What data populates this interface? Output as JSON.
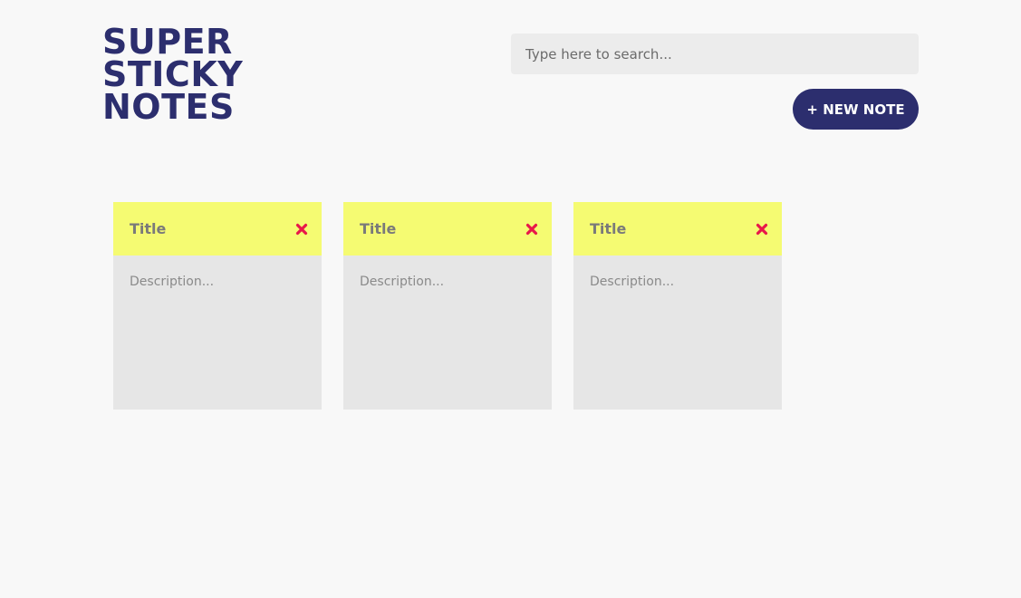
{
  "header": {
    "logo_lines": [
      "SUPER",
      "STICKY",
      "NOTES"
    ],
    "search_placeholder": "Type here to search...",
    "new_note_label": "+ NEW NOTE"
  },
  "colors": {
    "brand": "#2c2e6e",
    "note_header": "#f5fb72",
    "note_body": "#e6e6e6",
    "delete": "#e8174a"
  },
  "notes": [
    {
      "title": "Title",
      "description": "Description...",
      "delete_icon": "close-x-icon"
    },
    {
      "title": "Title",
      "description": "Description...",
      "delete_icon": "close-x-icon"
    },
    {
      "title": "Title",
      "description": "Description...",
      "delete_icon": "close-x-icon"
    }
  ]
}
